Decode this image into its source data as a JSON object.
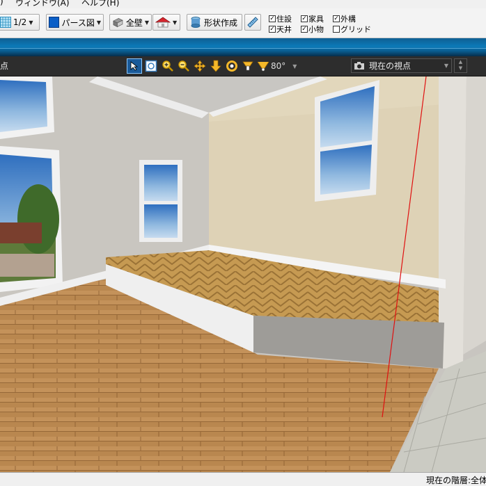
{
  "menu": {
    "items": [
      ")",
      "ウィンドウ(A)",
      "ヘルプ(H)"
    ]
  },
  "toolbar": {
    "scale_label": "1/2",
    "view_mode_label": "パース図",
    "wall_label": "全壁",
    "shape_create_label": "形状作成"
  },
  "display_options": [
    {
      "label": "住設",
      "checked": true
    },
    {
      "label": "家具",
      "checked": true
    },
    {
      "label": "外構",
      "checked": true
    },
    {
      "label": "天井",
      "checked": true
    },
    {
      "label": "小物",
      "checked": true
    },
    {
      "label": "グリッド",
      "checked": false
    }
  ],
  "viewbar": {
    "left_label": "点",
    "fov_label": "80°",
    "viewpoint_label": "現在の視点"
  },
  "icons": {
    "select": "cursor-arrow-icon",
    "fit": "fit-view-icon",
    "zoom_in": "zoom-in-icon",
    "zoom_out": "zoom-out-icon",
    "pan": "pan-icon",
    "walk": "walk-down-icon",
    "orbit": "orbit-icon",
    "camera": "camera-icon"
  },
  "colors": {
    "accent_blue": "#0c7ab8",
    "viewbar_bg": "#2d2d2d",
    "guide_line": "#e01010"
  },
  "status": {
    "current_floor": "現在の階層:全体"
  }
}
